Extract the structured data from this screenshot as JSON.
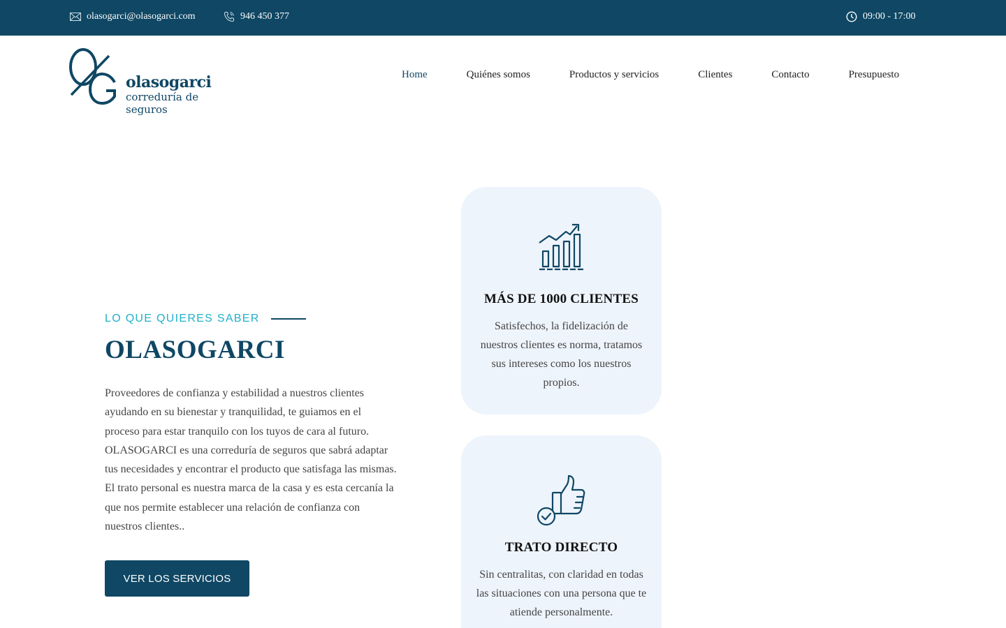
{
  "topbar": {
    "email": "olasogarci@olasogarci.com",
    "phone": "946 450 377",
    "hours": "09:00 - 17:00"
  },
  "logo": {
    "name": "olasogarci",
    "subtitle": "correduría de seguros"
  },
  "nav": {
    "items": [
      {
        "label": "Home",
        "active": true
      },
      {
        "label": "Quiénes somos"
      },
      {
        "label": "Productos y servicios"
      },
      {
        "label": "Clientes"
      },
      {
        "label": "Contacto"
      },
      {
        "label": "Presupuesto"
      }
    ]
  },
  "hero": {
    "eyebrow": "LO QUE QUIERES SABER",
    "title": "OLASOGARCI",
    "text": "Proveedores de confianza y estabilidad a nuestros clientes ayudando en su bienestar y tranquilidad, te guiamos en el proceso para estar tranquilo con los tuyos de cara al futuro. OLASOGARCI es una correduría de seguros que sabrá adaptar tus necesidades y encontrar el producto que satisfaga las mismas. El trato personal es nuestra marca de la casa y es esta cercanía la que nos permite establecer una relación de confianza con nuestros clientes..",
    "cta_label": "VER LOS SERVICIOS"
  },
  "cards": [
    {
      "icon": "growth-chart-icon",
      "title": "MÁS DE 1000 CLIENTES",
      "text": "Satisfechos, la fidelización de nuestros clientes es norma, tratamos sus intereses como los nuestros propios."
    },
    {
      "icon": "thumbs-up-check-icon",
      "title": "TRATO DIRECTO",
      "text": "Sin centralitas, con claridad en todas las situaciones con una persona que te atiende personalmente."
    }
  ],
  "colors": {
    "brand": "#0f4764",
    "accent": "#1fb0c8",
    "card_bg": "#eef4fc"
  }
}
